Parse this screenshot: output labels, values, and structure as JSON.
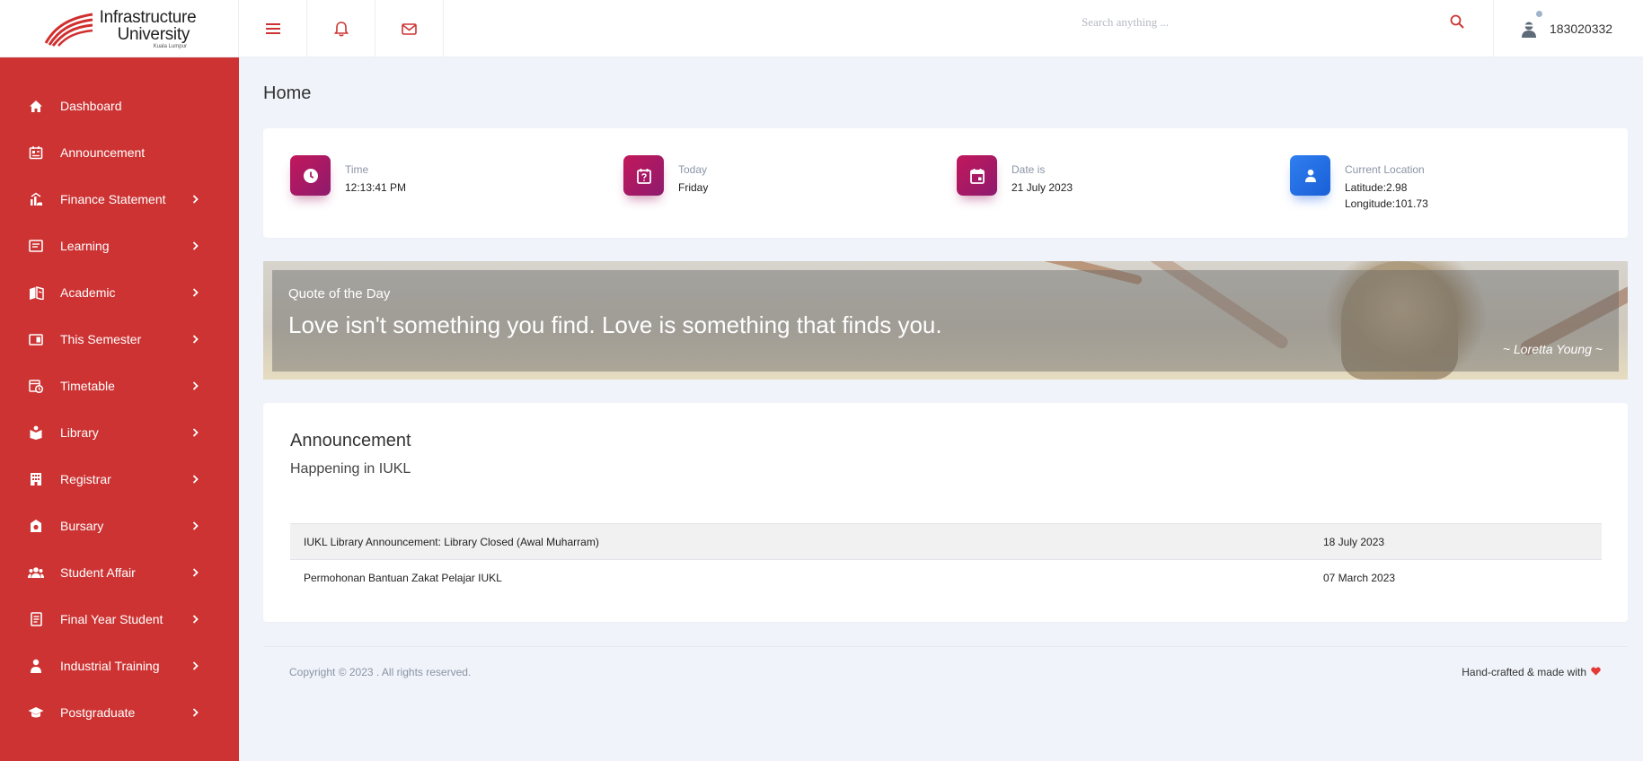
{
  "header": {
    "logo": {
      "line1": "Infrastructure",
      "line2": "University",
      "line3": "Kuala Lumpur"
    },
    "menu_icon": "hamburger-menu-icon",
    "notification_icon": "bell-icon",
    "mail_icon": "mail-icon",
    "search": {
      "placeholder": "Search anything ...",
      "value": ""
    },
    "user": {
      "id": "183020332",
      "icon": "user-avatar-icon"
    }
  },
  "sidebar": {
    "items": [
      {
        "label": "Dashboard",
        "icon": "home-icon",
        "expandable": false
      },
      {
        "label": "Announcement",
        "icon": "announcement-icon",
        "expandable": false
      },
      {
        "label": "Finance Statement",
        "icon": "finance-icon",
        "expandable": true
      },
      {
        "label": "Learning",
        "icon": "learning-icon",
        "expandable": true
      },
      {
        "label": "Academic",
        "icon": "academic-icon",
        "expandable": true
      },
      {
        "label": "This Semester",
        "icon": "semester-icon",
        "expandable": true
      },
      {
        "label": "Timetable",
        "icon": "timetable-icon",
        "expandable": true
      },
      {
        "label": "Library",
        "icon": "library-icon",
        "expandable": true
      },
      {
        "label": "Registrar",
        "icon": "registrar-icon",
        "expandable": true
      },
      {
        "label": "Bursary",
        "icon": "bursary-icon",
        "expandable": true
      },
      {
        "label": "Student Affair",
        "icon": "student-affair-icon",
        "expandable": true
      },
      {
        "label": "Final Year Student",
        "icon": "final-year-icon",
        "expandable": true
      },
      {
        "label": "Industrial Training",
        "icon": "industrial-training-icon",
        "expandable": true
      },
      {
        "label": "Postgraduate",
        "icon": "postgraduate-icon",
        "expandable": true
      }
    ],
    "color": "#cd3333"
  },
  "main": {
    "title": "Home",
    "stats": [
      {
        "label": "Time",
        "value": "12:13:41 PM",
        "icon": "clock-icon"
      },
      {
        "label": "Today",
        "value": "Friday",
        "icon": "calendar-question-icon"
      },
      {
        "label": "Date is",
        "value": "21 July 2023",
        "icon": "calendar-icon"
      },
      {
        "label": "Current Location",
        "value": "Latitude:2.98",
        "value2": "Longitude:101.73",
        "icon": "person-icon"
      }
    ],
    "quote": {
      "heading": "Quote of the Day",
      "text": "Love isn't something you find. Love is something that finds you.",
      "author": "~ Loretta Young ~"
    },
    "announcement": {
      "title": "Announcement",
      "subtitle": "Happening in IUKL",
      "rows": [
        {
          "title": "IUKL Library Announcement: Library Closed (Awal Muharram)",
          "date": "18 July 2023"
        },
        {
          "title": "Permohonan Bantuan Zakat Pelajar IUKL",
          "date": "07 March 2023"
        }
      ]
    }
  },
  "footer": {
    "copyright": "Copyright © 2023 . All rights reserved.",
    "made_with": "Hand-crafted & made with",
    "heart_icon": "heart-icon"
  },
  "colors": {
    "accent_red": "#cd3333",
    "badge_purple": "#a81c68",
    "badge_blue": "#2a74e8",
    "background": "#f0f3f9"
  }
}
